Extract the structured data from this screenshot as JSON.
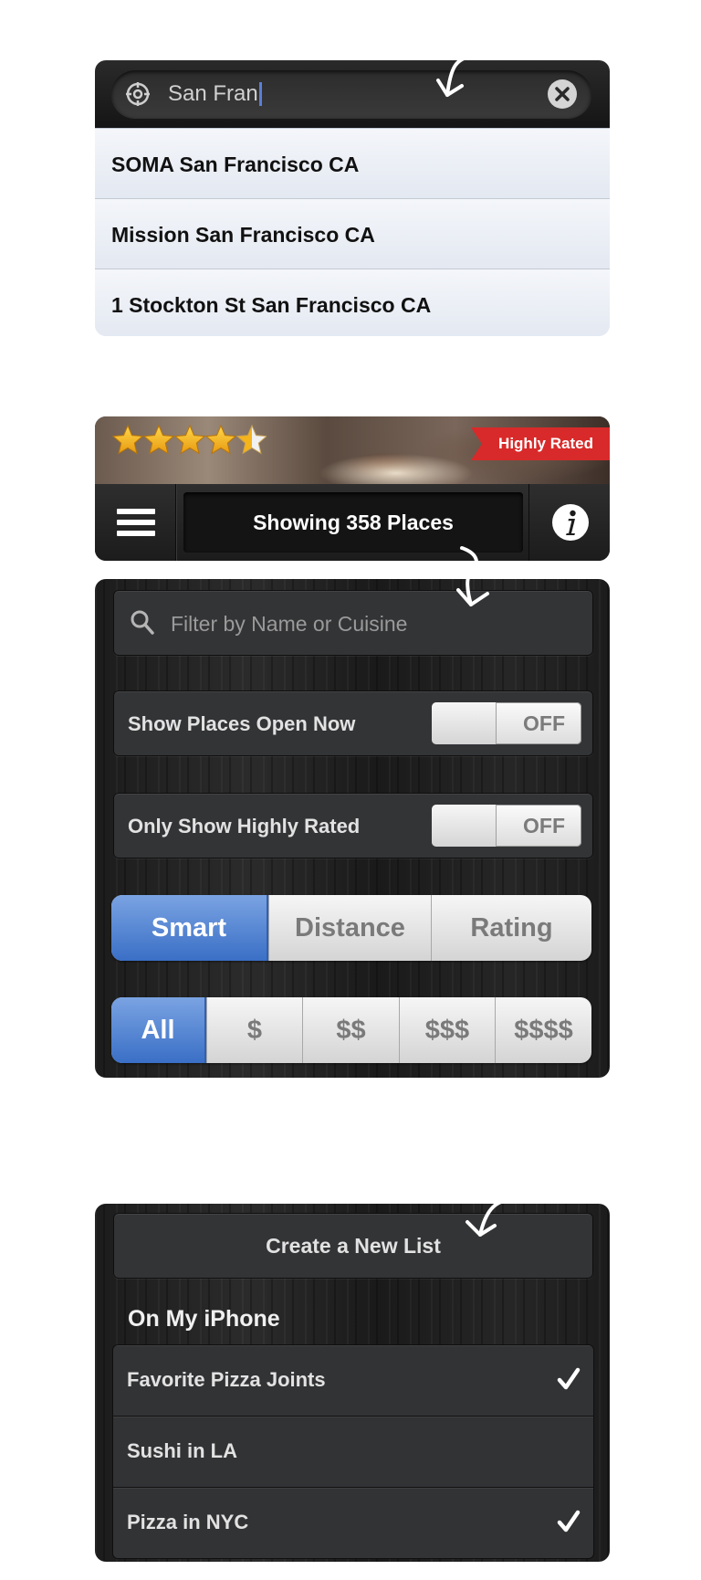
{
  "location_search": {
    "query": "San Fran",
    "suggestions": [
      "SOMA San Francisco CA",
      "Mission San Francisco CA",
      "1 Stockton St San Francisco CA"
    ]
  },
  "header": {
    "rating_stars": 4.5,
    "badge": "Highly Rated",
    "place_count_text": "Showing 358 Places"
  },
  "filters": {
    "search_placeholder": "Filter by Name or Cuisine",
    "open_now": {
      "label": "Show Places Open Now",
      "state": "OFF"
    },
    "highly_rated": {
      "label": "Only Show Highly Rated",
      "state": "OFF"
    },
    "sort_options": [
      "Smart",
      "Distance",
      "Rating"
    ],
    "sort_selected": "Smart",
    "price_options": [
      "All",
      "$",
      "$$",
      "$$$",
      "$$$$"
    ],
    "price_selected": "All"
  },
  "lists": {
    "create_label": "Create a New List",
    "section_title": "On My iPhone",
    "items": [
      {
        "name": "Favorite Pizza Joints",
        "checked": true
      },
      {
        "name": "Sushi in LA",
        "checked": false
      },
      {
        "name": "Pizza in NYC",
        "checked": true
      }
    ]
  },
  "colors": {
    "accent_blue": "#3a6fc6",
    "badge_red": "#d82a2a",
    "star_gold": "#f2b51c"
  }
}
